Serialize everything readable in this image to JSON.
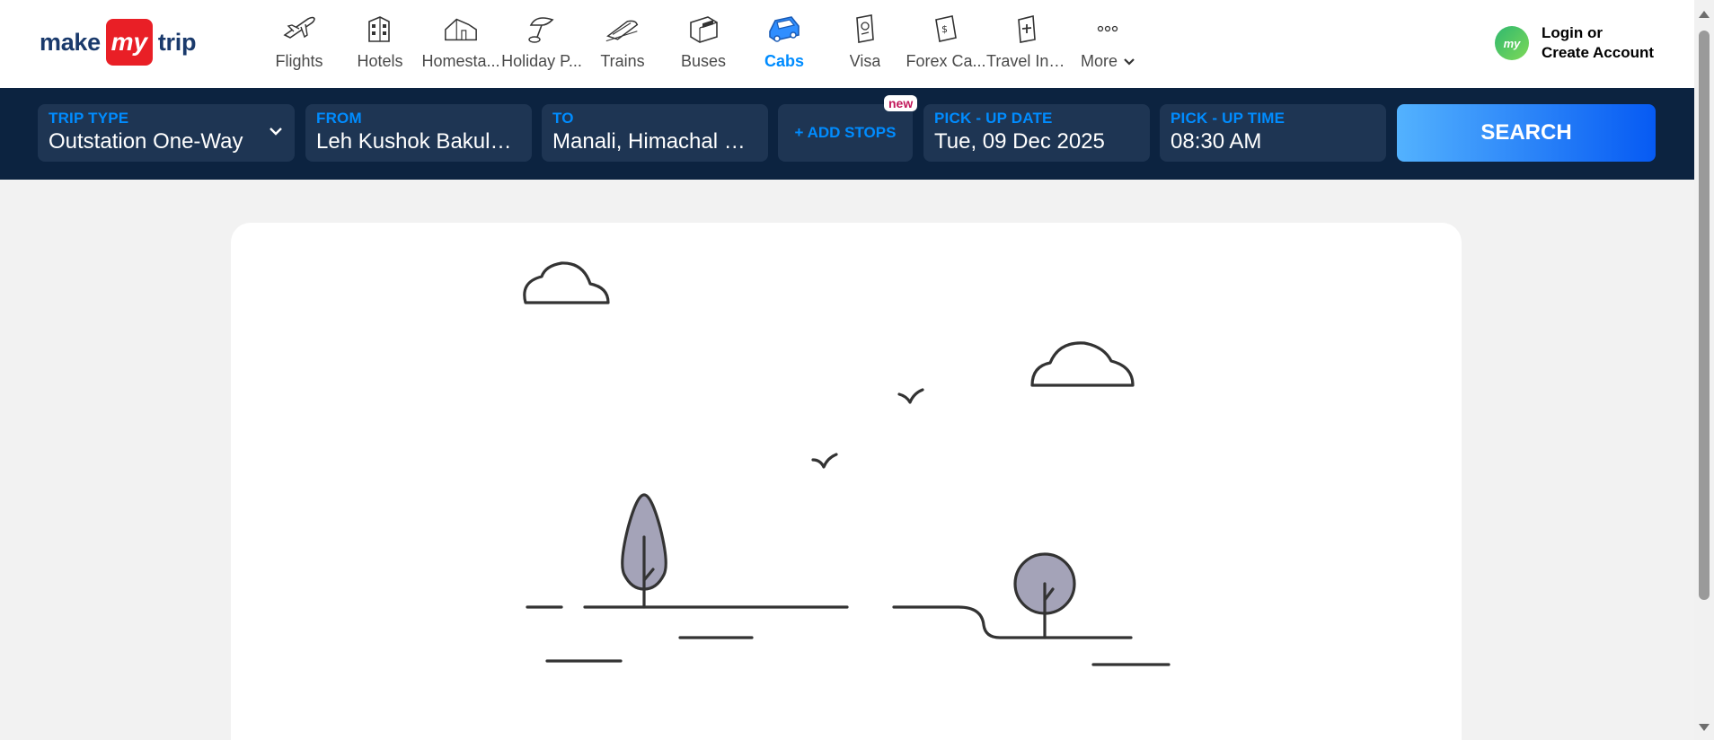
{
  "brand": {
    "part1": "make",
    "part2": "my",
    "part3": "trip"
  },
  "nav": {
    "items": [
      {
        "label": "Flights",
        "icon": "plane-icon"
      },
      {
        "label": "Hotels",
        "icon": "hotel-icon"
      },
      {
        "label": "Homesta...",
        "icon": "homestay-icon"
      },
      {
        "label": "Holiday P...",
        "icon": "holiday-icon"
      },
      {
        "label": "Trains",
        "icon": "train-icon"
      },
      {
        "label": "Buses",
        "icon": "bus-icon"
      },
      {
        "label": "Cabs",
        "icon": "cab-icon"
      },
      {
        "label": "Visa",
        "icon": "visa-icon"
      },
      {
        "label": "Forex Ca...",
        "icon": "forex-icon"
      },
      {
        "label": "Travel Ins...",
        "icon": "insurance-icon"
      },
      {
        "label": "More",
        "icon": "more-icon"
      }
    ],
    "active": "Cabs",
    "login_line1": "Login or",
    "login_line2": "Create Account",
    "avatar_text": "my"
  },
  "search": {
    "trip_type_label": "TRIP TYPE",
    "trip_type_value": "Outstation One-Way",
    "from_label": "FROM",
    "from_value": "Leh Kushok Bakula Rimpochee Airport",
    "to_label": "TO",
    "to_value": "Manali, Himachal Pradesh",
    "add_stops": "+ ADD STOPS",
    "new_badge": "new",
    "date_label": "PICK - UP DATE",
    "date_value": "Tue, 09 Dec 2025",
    "time_label": "PICK - UP TIME",
    "time_value": "08:30 AM",
    "search_button": "SEARCH"
  },
  "colors": {
    "brand_blue": "#008cff",
    "nav_dark": "#0c2340",
    "field_bg": "#1e3553",
    "brand_red": "#e91f26"
  }
}
